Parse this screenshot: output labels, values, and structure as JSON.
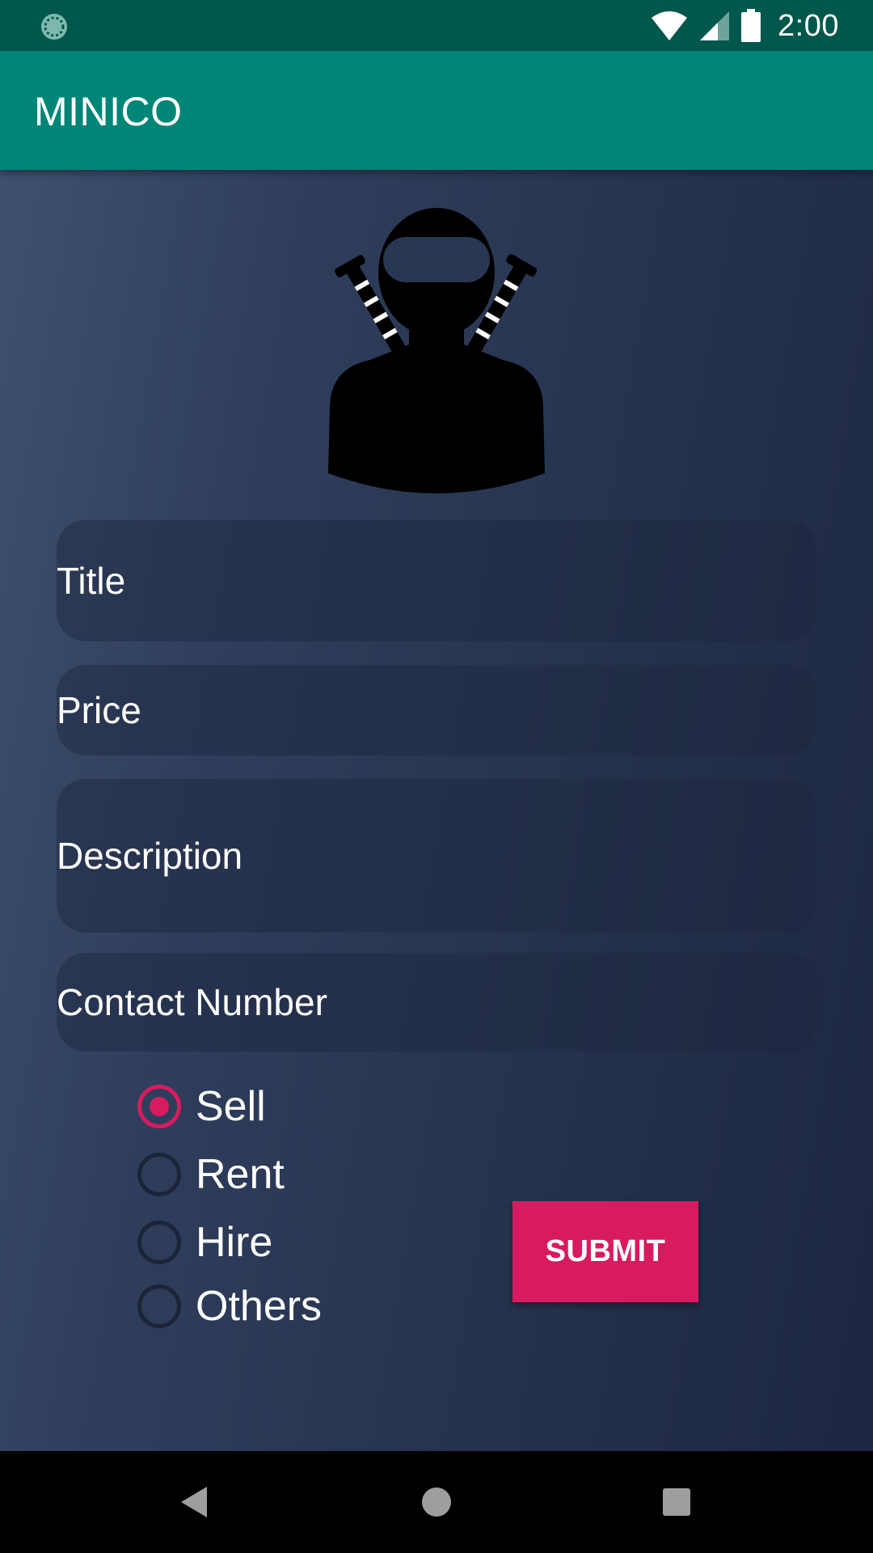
{
  "status_bar": {
    "time": "2:00",
    "left_icon": "sync-icon",
    "icons": [
      "wifi-icon",
      "signal-icon",
      "battery-icon"
    ]
  },
  "app_bar": {
    "title": "MINICO"
  },
  "avatar": {
    "icon": "ninja-avatar-icon"
  },
  "form": {
    "title_hint": "Title",
    "price_hint": "Price",
    "description_hint": "Description",
    "contact_hint": "Contact Number"
  },
  "radio_options": [
    {
      "label": "Sell",
      "checked": true
    },
    {
      "label": "Rent",
      "checked": false
    },
    {
      "label": "Hire",
      "checked": false
    },
    {
      "label": "Others",
      "checked": false
    }
  ],
  "submit_label": "SUBMIT",
  "nav_bar": {
    "buttons": [
      "back-icon",
      "home-icon",
      "recents-icon"
    ]
  },
  "colors": {
    "status_bar": "#00574b",
    "app_bar": "#008577",
    "accent": "#d81b60",
    "background_start": "#3d506c",
    "background_end": "#1c2640"
  }
}
